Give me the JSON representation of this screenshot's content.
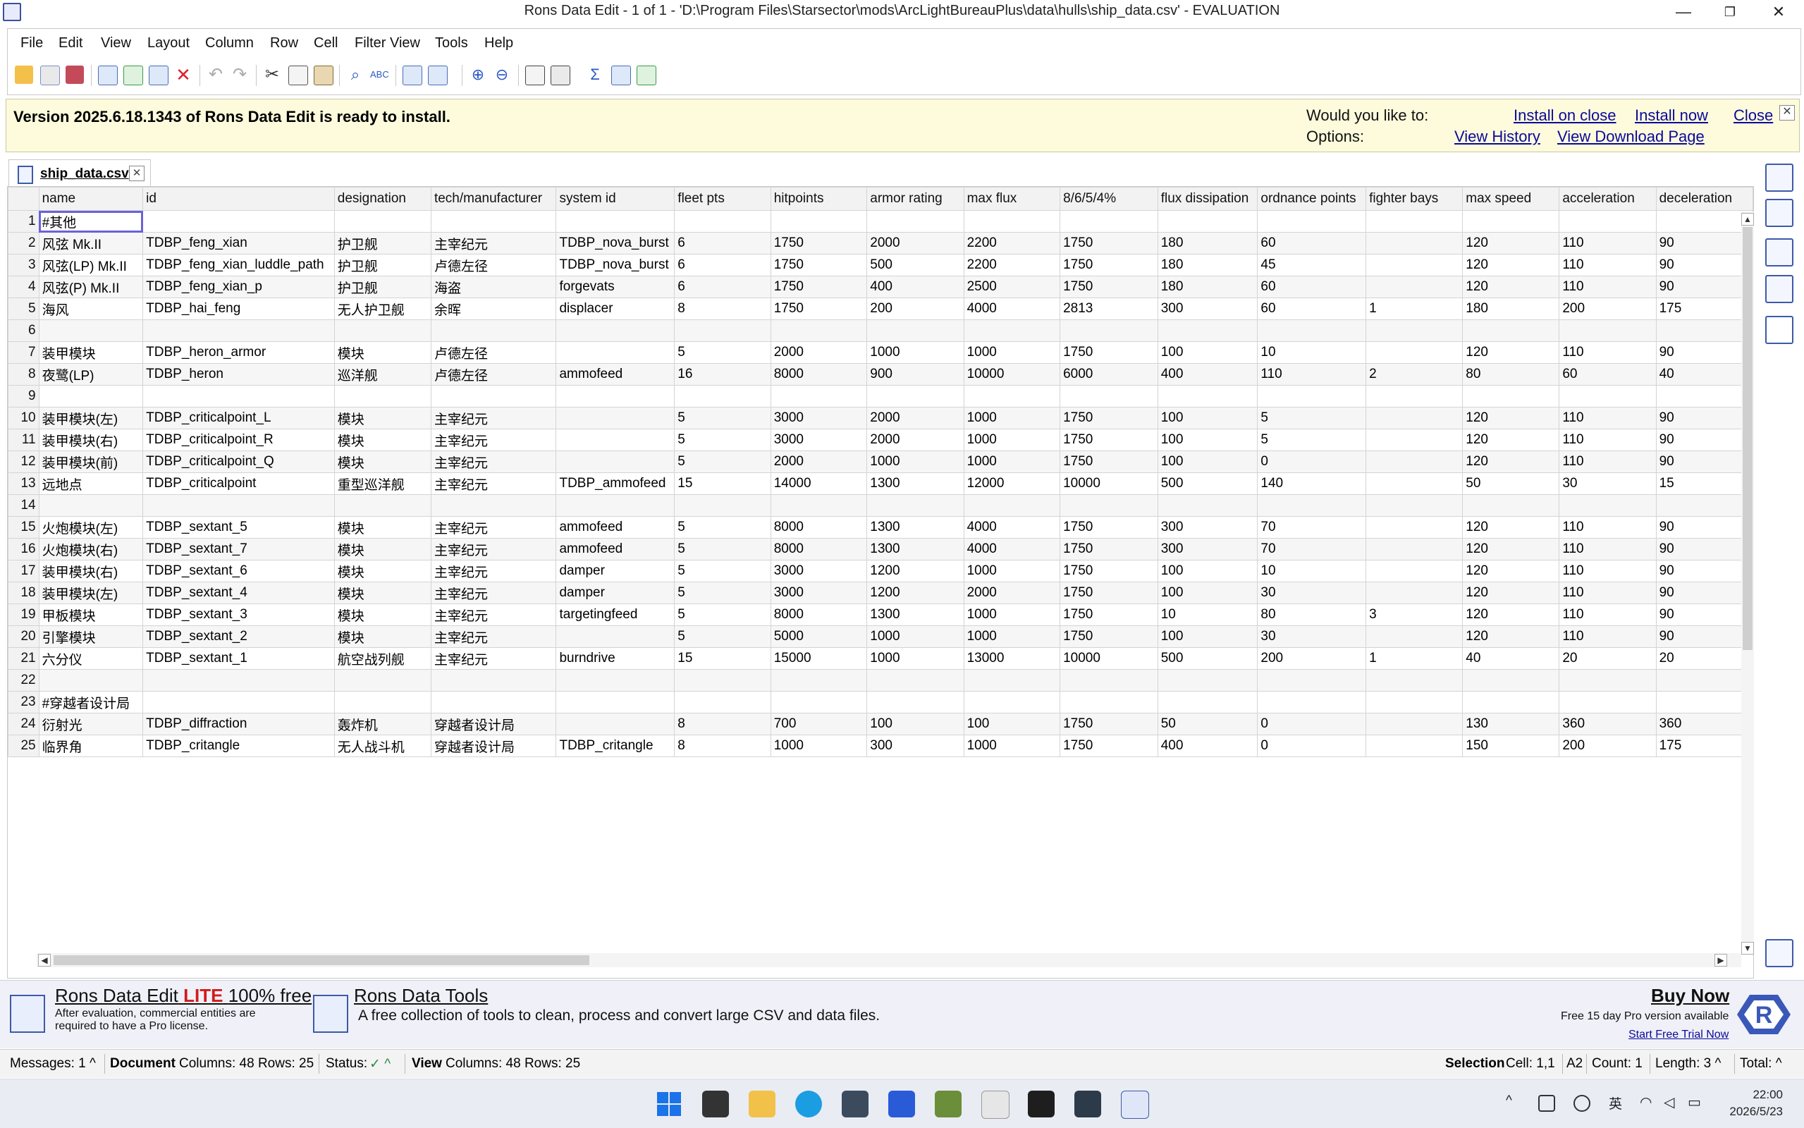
{
  "window": {
    "title": "Rons Data Edit - 1 of 1 - 'D:\\Program Files\\Starsector\\mods\\ArcLightBureauPlus\\data\\hulls\\ship_data.csv' - EVALUATION",
    "minimize": "—",
    "restore": "❐",
    "close": "✕"
  },
  "menu": [
    "File",
    "Edit",
    "View",
    "Layout",
    "Column",
    "Row",
    "Cell",
    "Filter View",
    "Tools",
    "Help"
  ],
  "banner": {
    "message": "Version 2025.6.18.1343 of Rons Data Edit is ready to install.",
    "question": "Would you like to:",
    "options_label": "Options:",
    "install_on_close": "Install on close",
    "install_now": "Install now",
    "close": "Close",
    "view_history": "View History",
    "view_download": "View Download Page",
    "close_x": "✕"
  },
  "tab": {
    "label": "ship_data.csv",
    "close": "✕"
  },
  "grid": {
    "columns": [
      "name",
      "id",
      "designation",
      "tech/manufacturer",
      "system id",
      "fleet pts",
      "hitpoints",
      "armor rating",
      "max flux",
      "8/6/5/4%",
      "flux dissipation",
      "ordnance points",
      "fighter bays",
      "max speed",
      "acceleration",
      "deceleration"
    ],
    "rows": [
      [
        "1",
        "#其他",
        "",
        "",
        "",
        "",
        "",
        "",
        "",
        "",
        "",
        "",
        "",
        "",
        "",
        "",
        ""
      ],
      [
        "2",
        "风弦 Mk.II",
        "TDBP_feng_xian",
        "护卫舰",
        "主宰纪元",
        "TDBP_nova_burst",
        "6",
        "1750",
        "2000",
        "2200",
        "1750",
        "180",
        "60",
        "",
        "120",
        "110",
        "90"
      ],
      [
        "3",
        "风弦(LP) Mk.II",
        "TDBP_feng_xian_luddle_path",
        "护卫舰",
        "卢德左径",
        "TDBP_nova_burst",
        "6",
        "1750",
        "500",
        "2200",
        "1750",
        "180",
        "45",
        "",
        "120",
        "110",
        "90"
      ],
      [
        "4",
        "风弦(P) Mk.II",
        "TDBP_feng_xian_p",
        "护卫舰",
        "海盗",
        "forgevats",
        "6",
        "1750",
        "400",
        "2500",
        "1750",
        "180",
        "60",
        "",
        "120",
        "110",
        "90"
      ],
      [
        "5",
        "海风",
        "TDBP_hai_feng",
        "无人护卫舰",
        "余晖",
        "displacer",
        "8",
        "1750",
        "200",
        "4000",
        "2813",
        "300",
        "60",
        "1",
        "180",
        "200",
        "175"
      ],
      [
        "6",
        "",
        "",
        "",
        "",
        "",
        "",
        "",
        "",
        "",
        "",
        "",
        "",
        "",
        "",
        "",
        ""
      ],
      [
        "7",
        "装甲模块",
        "TDBP_heron_armor",
        "模块",
        "卢德左径",
        "",
        "5",
        "2000",
        "1000",
        "1000",
        "1750",
        "100",
        "10",
        "",
        "120",
        "110",
        "90"
      ],
      [
        "8",
        "夜鹭(LP)",
        "TDBP_heron",
        "巡洋舰",
        "卢德左径",
        "ammofeed",
        "16",
        "8000",
        "900",
        "10000",
        "6000",
        "400",
        "110",
        "2",
        "80",
        "60",
        "40"
      ],
      [
        "9",
        "",
        "",
        "",
        "",
        "",
        "",
        "",
        "",
        "",
        "",
        "",
        "",
        "",
        "",
        "",
        ""
      ],
      [
        "10",
        "装甲模块(左)",
        "TDBP_criticalpoint_L",
        "模块",
        "主宰纪元",
        "",
        "5",
        "3000",
        "2000",
        "1000",
        "1750",
        "100",
        "5",
        "",
        "120",
        "110",
        "90"
      ],
      [
        "11",
        "装甲模块(右)",
        "TDBP_criticalpoint_R",
        "模块",
        "主宰纪元",
        "",
        "5",
        "3000",
        "2000",
        "1000",
        "1750",
        "100",
        "5",
        "",
        "120",
        "110",
        "90"
      ],
      [
        "12",
        "装甲模块(前)",
        "TDBP_criticalpoint_Q",
        "模块",
        "主宰纪元",
        "",
        "5",
        "2000",
        "1000",
        "1000",
        "1750",
        "100",
        "0",
        "",
        "120",
        "110",
        "90"
      ],
      [
        "13",
        "远地点",
        "TDBP_criticalpoint",
        "重型巡洋舰",
        "主宰纪元",
        "TDBP_ammofeed",
        "15",
        "14000",
        "1300",
        "12000",
        "10000",
        "500",
        "140",
        "",
        "50",
        "30",
        "15"
      ],
      [
        "14",
        "",
        "",
        "",
        "",
        "",
        "",
        "",
        "",
        "",
        "",
        "",
        "",
        "",
        "",
        "",
        ""
      ],
      [
        "15",
        "火炮模块(左)",
        "TDBP_sextant_5",
        "模块",
        "主宰纪元",
        "ammofeed",
        "5",
        "8000",
        "1300",
        "4000",
        "1750",
        "300",
        "70",
        "",
        "120",
        "110",
        "90"
      ],
      [
        "16",
        "火炮模块(右)",
        "TDBP_sextant_7",
        "模块",
        "主宰纪元",
        "ammofeed",
        "5",
        "8000",
        "1300",
        "4000",
        "1750",
        "300",
        "70",
        "",
        "120",
        "110",
        "90"
      ],
      [
        "17",
        "装甲模块(右)",
        "TDBP_sextant_6",
        "模块",
        "主宰纪元",
        "damper",
        "5",
        "3000",
        "1200",
        "1000",
        "1750",
        "100",
        "10",
        "",
        "120",
        "110",
        "90"
      ],
      [
        "18",
        "装甲模块(左)",
        "TDBP_sextant_4",
        "模块",
        "主宰纪元",
        "damper",
        "5",
        "3000",
        "1200",
        "2000",
        "1750",
        "100",
        "30",
        "",
        "120",
        "110",
        "90"
      ],
      [
        "19",
        "甲板模块",
        "TDBP_sextant_3",
        "模块",
        "主宰纪元",
        "targetingfeed",
        "5",
        "8000",
        "1300",
        "1000",
        "1750",
        "10",
        "80",
        "3",
        "120",
        "110",
        "90"
      ],
      [
        "20",
        "引擎模块",
        "TDBP_sextant_2",
        "模块",
        "主宰纪元",
        "",
        "5",
        "5000",
        "1000",
        "1000",
        "1750",
        "100",
        "30",
        "",
        "120",
        "110",
        "90"
      ],
      [
        "21",
        "六分仪",
        "TDBP_sextant_1",
        "航空战列舰",
        "主宰纪元",
        "burndrive",
        "15",
        "15000",
        "1000",
        "13000",
        "10000",
        "500",
        "200",
        "1",
        "40",
        "20",
        "20"
      ],
      [
        "22",
        "",
        "",
        "",
        "",
        "",
        "",
        "",
        "",
        "",
        "",
        "",
        "",
        "",
        "",
        "",
        ""
      ],
      [
        "23",
        "#穿越者设计局",
        "",
        "",
        "",
        "",
        "",
        "",
        "",
        "",
        "",
        "",
        "",
        "",
        "",
        "",
        ""
      ],
      [
        "24",
        "衍射光",
        "TDBP_diffraction",
        "轰炸机",
        "穿越者设计局",
        "",
        "8",
        "700",
        "100",
        "100",
        "1750",
        "50",
        "0",
        "",
        "130",
        "360",
        "360"
      ],
      [
        "25",
        "临界角",
        "TDBP_critangle",
        "无人战斗机",
        "穿越者设计局",
        "TDBP_critangle",
        "8",
        "1000",
        "300",
        "1000",
        "1750",
        "400",
        "0",
        "",
        "150",
        "200",
        "175"
      ]
    ]
  },
  "promo": {
    "product_title": "Rons Data Edit",
    "lite": "LITE",
    "free": "100% free",
    "note1": "After evaluation, commercial entities are",
    "note2": "required to have a Pro license.",
    "tools_title": "Rons Data Tools",
    "tools_desc": "A free collection of tools to clean, process and convert large CSV and data files.",
    "buy_now": "Buy Now",
    "trial_note": "Free 15 day Pro version available",
    "start_trial": "Start Free Trial Now"
  },
  "status": {
    "messages": "Messages: 1 ^",
    "document_label": "Document",
    "document_value": "Columns: 48 Rows: 25",
    "status_label": "Status:",
    "status_icon": "✓ ^",
    "view_label": "View",
    "view_value": "Columns: 48 Rows: 25",
    "selection_label": "Selection",
    "selection_cell": "Cell: 1,1",
    "selection_ref": "A2",
    "selection_count": "Count: 1",
    "selection_length": "Length: 3 ^",
    "selection_total": "Total: ^"
  },
  "taskbar": {
    "ime": "英",
    "time": "22:00",
    "date": "2026/5/23",
    "chevron": "^"
  },
  "colors": {
    "banner_bg": "#fdfbdc",
    "link": "#0a0a9a",
    "selection_outline": "#6a62d8",
    "accent": "#3c5aa8"
  }
}
